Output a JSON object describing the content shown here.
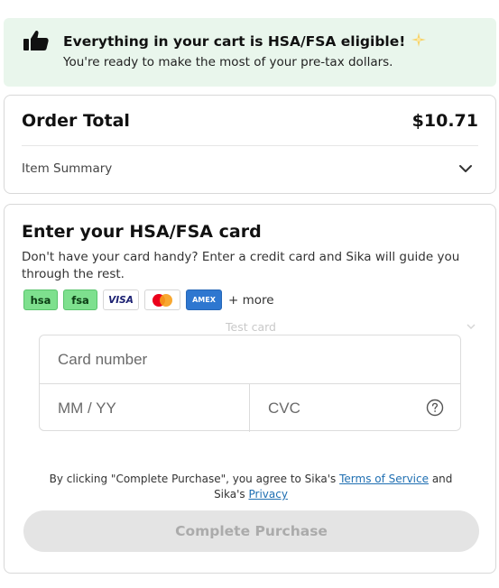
{
  "banner": {
    "icon": "thumbs-up-icon",
    "title": "Everything in your cart is HSA/FSA eligible!",
    "sparkle_icon": "sparkle-icon",
    "subtitle": "You're ready to make the most of your pre-tax dollars."
  },
  "order": {
    "label": "Order Total",
    "total": "$10.71",
    "summary_label": "Item Summary",
    "summary_icon": "chevron-down-icon"
  },
  "payment": {
    "heading": "Enter your HSA/FSA card",
    "description": "Don't have your card handy? Enter a credit card and Sika will guide you through the rest.",
    "logos": [
      "hsa",
      "fsa",
      "VISA",
      "mastercard",
      "AMEX"
    ],
    "logo_text": {
      "hsa": "hsa",
      "fsa": "fsa",
      "visa": "VISA",
      "amex": "AMEX"
    },
    "more_label": "+ more",
    "test_card_label": "Test card",
    "card_number_placeholder": "Card number",
    "expiry_placeholder": "MM / YY",
    "cvc_placeholder": "CVC"
  },
  "legal": {
    "prefix": "By clicking \"Complete Purchase\", you agree to Sika's",
    "terms_link": "Terms of Service",
    "and": "and",
    "sika": "Sika's",
    "privacy_link": "Privacy"
  },
  "cta": {
    "label": "Complete Purchase",
    "disabled": true
  },
  "colors": {
    "banner_bg": "#e9f6ec",
    "hsa_green": "#7ee08e",
    "link_blue": "#1f6fb2",
    "button_disabled_bg": "#e4e4e4"
  }
}
